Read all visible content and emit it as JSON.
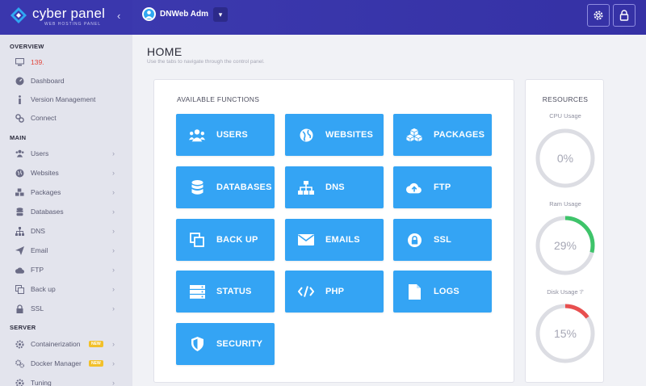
{
  "brand": {
    "name": "cyber panel",
    "tagline": "WEB HOSTING PANEL"
  },
  "topbar": {
    "user_name": "DNWeb Adm"
  },
  "sidebar": {
    "overview_heading": "OVERVIEW",
    "main_heading": "MAIN",
    "server_heading": "SERVER",
    "overview_items": [
      {
        "label": "139.",
        "icon": "monitor-icon"
      },
      {
        "label": "Dashboard",
        "icon": "dashboard-icon"
      },
      {
        "label": "Version Management",
        "icon": "info-icon"
      },
      {
        "label": "Connect",
        "icon": "link-icon"
      }
    ],
    "main_items": [
      {
        "label": "Users",
        "icon": "users-icon"
      },
      {
        "label": "Websites",
        "icon": "globe-icon"
      },
      {
        "label": "Packages",
        "icon": "packages-icon"
      },
      {
        "label": "Databases",
        "icon": "database-icon"
      },
      {
        "label": "DNS",
        "icon": "sitemap-icon"
      },
      {
        "label": "Email",
        "icon": "send-icon"
      },
      {
        "label": "FTP",
        "icon": "cloud-upload-icon"
      },
      {
        "label": "Back up",
        "icon": "copy-icon"
      },
      {
        "label": "SSL",
        "icon": "lock-icon"
      }
    ],
    "server_items": [
      {
        "label": "Containerization",
        "icon": "gear-icon",
        "badge": "NEW"
      },
      {
        "label": "Docker Manager",
        "icon": "gears-icon",
        "badge": "NEW"
      },
      {
        "label": "Tuning",
        "icon": "gear-icon"
      }
    ]
  },
  "main": {
    "title": "HOME",
    "subtitle": "Use the tabs to navigate through the control panel.",
    "functions_heading": "AVAILABLE FUNCTIONS",
    "tiles": [
      {
        "label": "USERS",
        "icon": "users-icon"
      },
      {
        "label": "WEBSITES",
        "icon": "globe-icon"
      },
      {
        "label": "PACKAGES",
        "icon": "packages-icon"
      },
      {
        "label": "DATABASES",
        "icon": "database-icon"
      },
      {
        "label": "DNS",
        "icon": "sitemap-icon"
      },
      {
        "label": "FTP",
        "icon": "cloud-upload-icon"
      },
      {
        "label": "BACK UP",
        "icon": "copy-icon"
      },
      {
        "label": "EMAILS",
        "icon": "envelope-icon"
      },
      {
        "label": "SSL",
        "icon": "lock-icon"
      },
      {
        "label": "STATUS",
        "icon": "server-icon"
      },
      {
        "label": "PHP",
        "icon": "code-icon"
      },
      {
        "label": "LOGS",
        "icon": "file-icon"
      },
      {
        "label": "SECURITY",
        "icon": "shield-icon"
      }
    ]
  },
  "resources": {
    "heading": "RESOURCES",
    "cpu": {
      "label": "CPU Usage",
      "value": "0%",
      "percent": 0
    },
    "ram": {
      "label": "Ram Usage",
      "value": "29%",
      "percent": 29
    },
    "disk": {
      "label": "Disk Usage '/'",
      "value": "15%",
      "percent": 15
    }
  },
  "colors": {
    "topbar": "#3531a5",
    "tile": "#34a4f4",
    "ram_arc": "#3ec46a",
    "disk_arc": "#e84f4f",
    "gauge_track": "#dcdde3"
  }
}
